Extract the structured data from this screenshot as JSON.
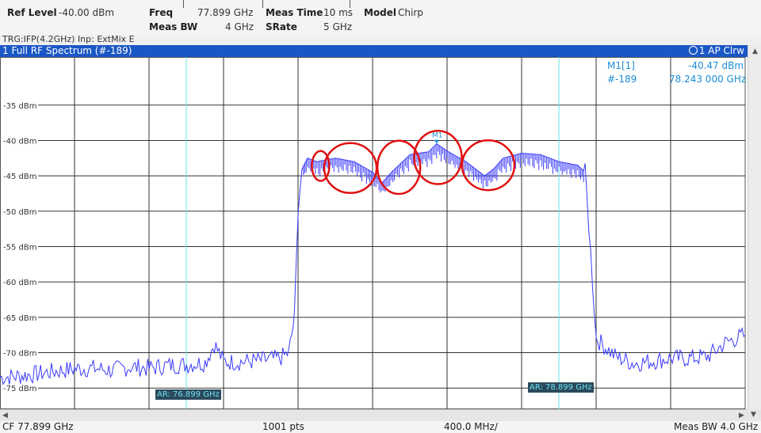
{
  "header": {
    "ref_level_label": "Ref Level",
    "ref_level_value": "-40.00 dBm",
    "freq_label": "Freq",
    "freq_value": "77.899 GHz",
    "meas_time_label": "Meas Time",
    "meas_time_value": "10 ms",
    "model_label": "Model",
    "model_value": "Chirp",
    "meas_bw_label": "Meas BW",
    "meas_bw_value": "4 GHz",
    "srate_label": "SRate",
    "srate_value": "5 GHz"
  },
  "trigger_line": "TRG:IFP(4.2GHz) Inp: ExtMix E",
  "window": {
    "title": "1 Full RF Spectrum (#-189)",
    "trace_info": "1 AP Clrw"
  },
  "marker": {
    "name_label": "M1[1]",
    "level": "-40.47 dBm",
    "sweep": "#-189",
    "freq": "78.243 000 GHz",
    "plot_label": "M1"
  },
  "ar_labels": {
    "left": "AR: 76.899 GHz",
    "right": "AR: 78.899 GHz"
  },
  "footer": {
    "cf": "CF 77.899 GHz",
    "pts": "1001 pts",
    "span": "400.0 MHz/",
    "meas_bw": "Meas BW 4.0 GHz"
  },
  "colors": {
    "trace": "#3a3aff",
    "title_bar": "#1a57c6",
    "annotation": "#e01010",
    "cursor": "#66e0ee"
  },
  "chart_data": {
    "type": "line",
    "y_tick_labels": [
      "-35 dBm",
      "-40 dBm",
      "-45 dBm",
      "-50 dBm",
      "-55 dBm",
      "-60 dBm",
      "-65 dBm",
      "-70 dBm",
      "-75 dBm"
    ],
    "y_ticks": [
      -35,
      -40,
      -45,
      -50,
      -55,
      -60,
      -65,
      -70,
      -75
    ],
    "ylim": [
      -78,
      -28.2
    ],
    "xlim_ghz": [
      75.899,
      79.899
    ],
    "x_gridlines_ghz": [
      76.299,
      76.699,
      77.099,
      77.499,
      77.899,
      78.299,
      78.699,
      79.099,
      79.499
    ],
    "ar_lines_ghz": [
      76.899,
      78.899
    ],
    "grid": true,
    "series": [
      {
        "points": [
          [
            75.899,
            -73.5
          ],
          [
            76.0,
            -73.3
          ],
          [
            76.1,
            -73.0
          ],
          [
            76.2,
            -72.6
          ],
          [
            76.3,
            -72.3
          ],
          [
            76.4,
            -72.2
          ],
          [
            76.5,
            -72.5
          ],
          [
            76.6,
            -72.0
          ],
          [
            76.7,
            -72.2
          ],
          [
            76.8,
            -71.8
          ],
          [
            76.9,
            -71.7
          ],
          [
            77.0,
            -71.4
          ],
          [
            77.05,
            -68.8
          ],
          [
            77.1,
            -71.3
          ],
          [
            77.2,
            -71.3
          ],
          [
            77.3,
            -71.1
          ],
          [
            77.4,
            -70.8
          ],
          [
            77.45,
            -70.0
          ],
          [
            77.48,
            -65.0
          ],
          [
            77.5,
            -49.0
          ],
          [
            77.52,
            -44.0
          ],
          [
            77.55,
            -42.5
          ],
          [
            77.6,
            -43.0
          ],
          [
            77.7,
            -42.5
          ],
          [
            77.8,
            -43.0
          ],
          [
            77.9,
            -44.5
          ],
          [
            77.95,
            -46.0
          ],
          [
            78.0,
            -44.5
          ],
          [
            78.1,
            -42.0
          ],
          [
            78.2,
            -41.6
          ],
          [
            78.243,
            -40.47
          ],
          [
            78.3,
            -41.5
          ],
          [
            78.4,
            -43.0
          ],
          [
            78.5,
            -45.0
          ],
          [
            78.55,
            -44.0
          ],
          [
            78.6,
            -42.5
          ],
          [
            78.7,
            -41.8
          ],
          [
            78.8,
            -42.0
          ],
          [
            78.9,
            -43.0
          ],
          [
            79.0,
            -43.5
          ],
          [
            79.04,
            -44.5
          ],
          [
            79.06,
            -52.0
          ],
          [
            79.08,
            -60.0
          ],
          [
            79.1,
            -68.0
          ],
          [
            79.2,
            -70.5
          ],
          [
            79.3,
            -71.5
          ],
          [
            79.4,
            -71.2
          ],
          [
            79.5,
            -70.8
          ],
          [
            79.6,
            -70.8
          ],
          [
            79.7,
            -70.5
          ],
          [
            79.8,
            -68.5
          ],
          [
            79.85,
            -68.0
          ],
          [
            79.899,
            -67.5
          ]
        ]
      }
    ]
  }
}
